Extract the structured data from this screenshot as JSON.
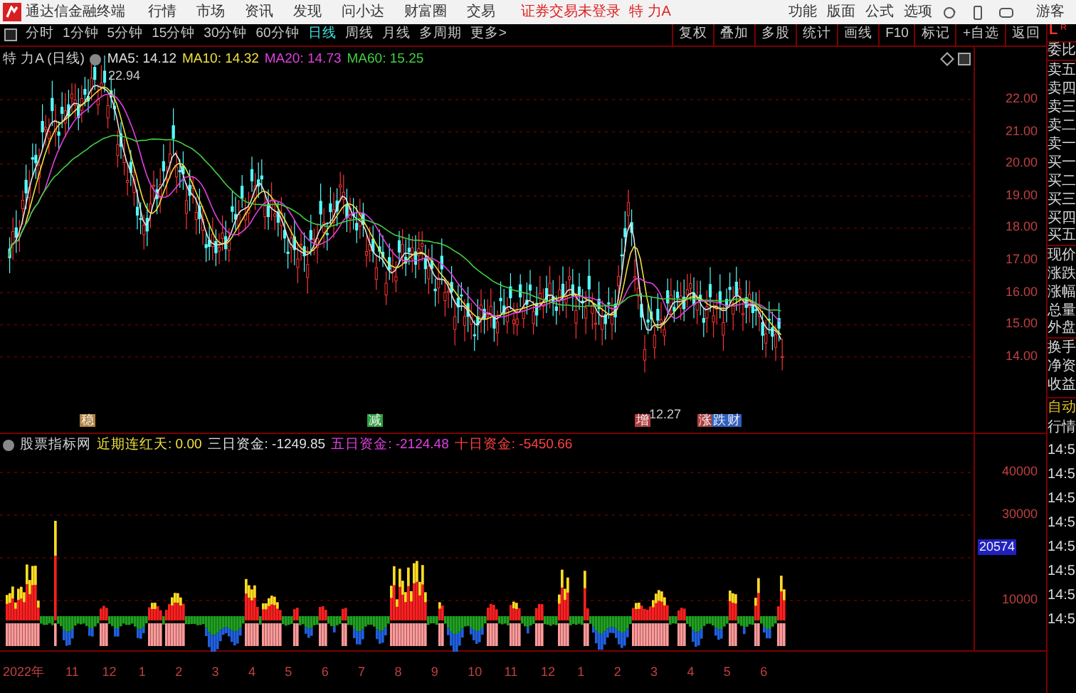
{
  "menu_bar": {
    "app_title": "通达信金融终端",
    "items": [
      "行情",
      "市场",
      "资讯",
      "发现",
      "问小达",
      "财富圈",
      "交易"
    ],
    "notice": "证券交易未登录",
    "stock": "特 力A",
    "right_items": [
      "功能",
      "版面",
      "公式",
      "选项"
    ],
    "user": "游客"
  },
  "period_tabs": [
    {
      "label": "分时",
      "selected": false
    },
    {
      "label": "1分钟",
      "selected": false
    },
    {
      "label": "5分钟",
      "selected": false
    },
    {
      "label": "15分钟",
      "selected": false
    },
    {
      "label": "30分钟",
      "selected": false
    },
    {
      "label": "60分钟",
      "selected": false
    },
    {
      "label": "日线",
      "selected": true
    },
    {
      "label": "周线",
      "selected": false
    },
    {
      "label": "月线",
      "selected": false
    },
    {
      "label": "多周期",
      "selected": false
    },
    {
      "label": "更多>",
      "selected": false
    }
  ],
  "tool_buttons": [
    "复权",
    "叠加",
    "多股",
    "统计",
    "画线",
    "F10",
    "标记",
    "+自选",
    "返回"
  ],
  "price_chart": {
    "title": "特 力A (日线)",
    "ma": [
      {
        "label": "MA5: 14.12",
        "color": "#e0e0e0"
      },
      {
        "label": "MA10: 14.32",
        "color": "#f0e040"
      },
      {
        "label": "MA20: 14.73",
        "color": "#e040e0"
      },
      {
        "label": "MA60: 15.25",
        "color": "#40d040"
      }
    ],
    "high_label": "22.94",
    "low_label": "12.27",
    "markers": [
      {
        "text": "稳",
        "color": "#b08040"
      },
      {
        "text": "减",
        "color": "#30a040"
      },
      {
        "text": "增",
        "color": "#b04040"
      },
      {
        "text": "涨",
        "color": "#b04040"
      },
      {
        "text": "跌",
        "color": "#3060c0"
      },
      {
        "text": "财",
        "color": "#3060c0"
      }
    ],
    "price_ticks": [
      "22.00",
      "21.00",
      "20.00",
      "19.00",
      "18.00",
      "17.00",
      "16.00",
      "15.00",
      "14.00"
    ]
  },
  "indicator": {
    "name": "股票指标网",
    "values": [
      {
        "label": "近期连红天: 0.00",
        "color": "#f0e040"
      },
      {
        "label": "三日资金: -1249.85",
        "color": "#e0e0e0"
      },
      {
        "label": "五日资金: -2124.48",
        "color": "#e040e0"
      },
      {
        "label": "十日资金: -5450.66",
        "color": "#ff4040"
      }
    ],
    "ticks": [
      "40000",
      "30000",
      "10000"
    ],
    "cursor_value": "20574"
  },
  "date_axis": [
    "2022年",
    "11",
    "12",
    "1",
    "2",
    "3",
    "4",
    "5",
    "6",
    "7",
    "8",
    "9",
    "10",
    "11",
    "12",
    "1",
    "2",
    "3",
    "4",
    "5",
    "6"
  ],
  "quote_panel": {
    "header_left": "L",
    "header_right": "R",
    "rows": [
      "委比",
      "卖五",
      "卖四",
      "卖三",
      "卖二",
      "卖一",
      "买一",
      "买二",
      "买三",
      "买四",
      "买五",
      "现价",
      "涨跌",
      "涨幅",
      "总量",
      "外盘",
      "换手",
      "净资",
      "收益"
    ],
    "section": "自动",
    "section_2": "行情",
    "times": [
      "14:5",
      "14:5",
      "14:5",
      "14:5",
      "14:5",
      "14:5",
      "14:5",
      "14:5"
    ]
  }
}
